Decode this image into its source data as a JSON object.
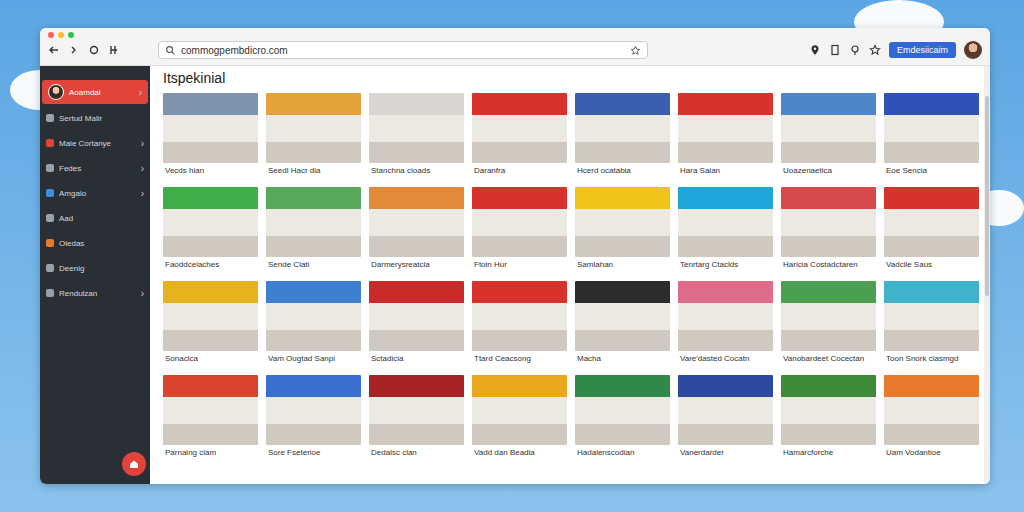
{
  "window": {
    "url": "commogpembdicro.com",
    "action_button": "Emdesiicaim"
  },
  "sidebar": {
    "items": [
      {
        "label": "Aoamdal",
        "selected": true,
        "chevron": "›",
        "color": "#e0443a"
      },
      {
        "label": "Sertud Malir",
        "selected": false,
        "chevron": "",
        "color": "#9aa0a8"
      },
      {
        "label": "Maie Cortanye",
        "selected": false,
        "chevron": "›",
        "color": "#e0443a"
      },
      {
        "label": "Fedes",
        "selected": false,
        "chevron": "›",
        "color": "#9aa0a8"
      },
      {
        "label": "Amgalo",
        "selected": false,
        "chevron": "›",
        "color": "#3a8fe0"
      },
      {
        "label": "Aad",
        "selected": false,
        "chevron": "",
        "color": "#9aa0a8"
      },
      {
        "label": "Oiedas",
        "selected": false,
        "chevron": "",
        "color": "#e8792a"
      },
      {
        "label": "Deenig",
        "selected": false,
        "chevron": "",
        "color": "#9aa0a8"
      },
      {
        "label": "Rendulzan",
        "selected": false,
        "chevron": "›",
        "color": "#9aa0a8"
      }
    ]
  },
  "page": {
    "title": "Itspekinial"
  },
  "cards": [
    {
      "caption": "Vecds hian",
      "color": "#7f93ad"
    },
    {
      "caption": "Seedl Hacr dia",
      "color": "#e3a23a"
    },
    {
      "caption": "Stanchna cioads",
      "color": "#d9d6d2"
    },
    {
      "caption": "Daranfra",
      "color": "#d8322c"
    },
    {
      "caption": "Hcerd ocatabia",
      "color": "#3a5fb0"
    },
    {
      "caption": "Hara Saian",
      "color": "#d8322c"
    },
    {
      "caption": "Uoazenaetica",
      "color": "#4d86c9"
    },
    {
      "caption": "Eoe Sencia",
      "color": "#2f52b8"
    },
    {
      "caption": "Faoddceiaches",
      "color": "#3fae48"
    },
    {
      "caption": "Sende Clati",
      "color": "#57a85a"
    },
    {
      "caption": "Darmerysreatcla",
      "color": "#e08a3a"
    },
    {
      "caption": "Ftoin Hur",
      "color": "#d8322c"
    },
    {
      "caption": "Samlahan",
      "color": "#f0c419"
    },
    {
      "caption": "Tenrtarg Ctaclds",
      "color": "#1fa6d8"
    },
    {
      "caption": "Haricia Costadctaren",
      "color": "#d84a4a"
    },
    {
      "caption": "Vadclie Saus",
      "color": "#d8322c"
    },
    {
      "caption": "Sonaclca",
      "color": "#e6b21e"
    },
    {
      "caption": "Vam Ougtad Sanpi",
      "color": "#3d7fd0"
    },
    {
      "caption": "Sctadicia",
      "color": "#c92a2a"
    },
    {
      "caption": "Ttard Ceacsong",
      "color": "#d8322c"
    },
    {
      "caption": "Macha",
      "color": "#2c2c2c"
    },
    {
      "caption": "Vare'dasted Cocatn",
      "color": "#e06a8a"
    },
    {
      "caption": "Vanobardeet Cocectan",
      "color": "#4aa050"
    },
    {
      "caption": "Toon Snork ciasmgd",
      "color": "#3fb3c9"
    },
    {
      "caption": "Parnaing clam",
      "color": "#d8452c"
    },
    {
      "caption": "Sore Fseterioe",
      "color": "#3a6fd0"
    },
    {
      "caption": "Dedalsc clan",
      "color": "#a82424"
    },
    {
      "caption": "Vadd dan Beadia",
      "color": "#e9a81e"
    },
    {
      "caption": "Hadalenscodian",
      "color": "#2f8a4a"
    },
    {
      "caption": "Vanerdarder",
      "color": "#2c4aa0"
    },
    {
      "caption": "Hamarcforche",
      "color": "#3c8a3a"
    },
    {
      "caption": "Uam Vodantioe",
      "color": "#e8792a"
    }
  ]
}
